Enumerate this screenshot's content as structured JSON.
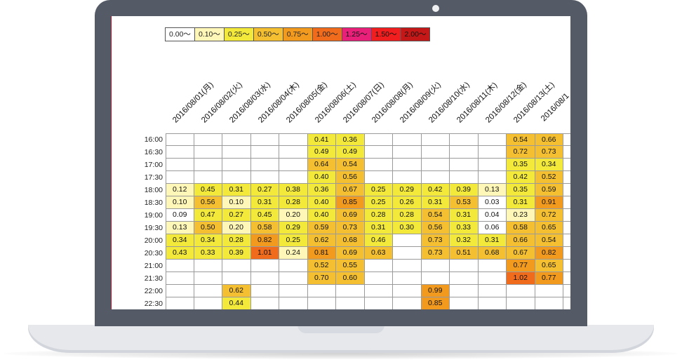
{
  "legend": [
    {
      "label": "0.00〜",
      "color": "#ffffff"
    },
    {
      "label": "0.10〜",
      "color": "#fff7b8"
    },
    {
      "label": "0.25〜",
      "color": "#f2e93a"
    },
    {
      "label": "0.50〜",
      "color": "#f4c032"
    },
    {
      "label": "0.75〜",
      "color": "#f29a1e"
    },
    {
      "label": "1.00〜",
      "color": "#f06b1c"
    },
    {
      "label": "1.25〜",
      "color": "#e8207a"
    },
    {
      "label": "1.50〜",
      "color": "#f01e1e"
    },
    {
      "label": "2.00〜",
      "color": "#c41818"
    }
  ],
  "dates": [
    "2016/08/01(月)",
    "2016/08/02(火)",
    "2016/08/03(水)",
    "2016/08/04(木)",
    "2016/08/05(金)",
    "2016/08/06(土)",
    "2016/08/07(日)",
    "2016/08/08(月)",
    "2016/08/09(火)",
    "2016/08/10(水)",
    "2016/08/11(木)",
    "2016/08/12(金)",
    "2016/08/13(土)",
    "2016/08/1"
  ],
  "times": [
    "16:00",
    "16:30",
    "17:00",
    "17:30",
    "18:00",
    "18:30",
    "19:00",
    "19:30",
    "20:00",
    "20:30",
    "21:00",
    "21:30",
    "22:00",
    "22:30"
  ],
  "rows": [
    [
      "",
      "",
      "",
      "",
      "",
      "0.41",
      "0.36",
      "",
      "",
      "",
      "",
      "",
      "0.54",
      "0.66",
      ""
    ],
    [
      "",
      "",
      "",
      "",
      "",
      "0.49",
      "0.49",
      "",
      "",
      "",
      "",
      "",
      "0.72",
      "0.73",
      ""
    ],
    [
      "",
      "",
      "",
      "",
      "",
      "0.64",
      "0.54",
      "",
      "",
      "",
      "",
      "",
      "0.35",
      "0.34",
      ""
    ],
    [
      "",
      "",
      "",
      "",
      "",
      "0.40",
      "0.56",
      "",
      "",
      "",
      "",
      "",
      "0.42",
      "0.52",
      ""
    ],
    [
      "0.12",
      "0.45",
      "0.31",
      "0.27",
      "0.38",
      "0.36",
      "0.67",
      "0.25",
      "0.29",
      "0.42",
      "0.39",
      "0.13",
      "0.35",
      "0.59",
      ""
    ],
    [
      "0.10",
      "0.56",
      "0.10",
      "0.31",
      "0.28",
      "0.40",
      "0.85",
      "0.25",
      "0.26",
      "0.31",
      "0.53",
      "0.03",
      "0.31",
      "0.91",
      ""
    ],
    [
      "0.09",
      "0.47",
      "0.27",
      "0.45",
      "0.20",
      "0.40",
      "0.69",
      "0.28",
      "0.28",
      "0.54",
      "0.31",
      "0.04",
      "0.23",
      "0.72",
      ""
    ],
    [
      "0.13",
      "0.50",
      "0.20",
      "0.58",
      "0.29",
      "0.59",
      "0.73",
      "0.31",
      "0.30",
      "0.56",
      "0.33",
      "0.06",
      "0.58",
      "0.65",
      ""
    ],
    [
      "0.34",
      "0.34",
      "0.28",
      "0.82",
      "0.25",
      "0.62",
      "0.68",
      "0.46",
      "",
      "0.73",
      "0.32",
      "0.31",
      "0.66",
      "0.54",
      ""
    ],
    [
      "0.43",
      "0.33",
      "0.39",
      "1.01",
      "0.24",
      "0.81",
      "0.69",
      "0.63",
      "",
      "0.73",
      "0.51",
      "0.68",
      "0.67",
      "0.82",
      ""
    ],
    [
      "",
      "",
      "",
      "",
      "",
      "0.52",
      "0.55",
      "",
      "",
      "",
      "",
      "",
      "0.77",
      "0.65",
      ""
    ],
    [
      "",
      "",
      "",
      "",
      "",
      "0.70",
      "0.60",
      "",
      "",
      "",
      "",
      "",
      "1.02",
      "0.77",
      ""
    ],
    [
      "",
      "",
      "0.62",
      "",
      "",
      "",
      "",
      "",
      "",
      "0.99",
      "",
      "",
      "",
      "",
      ""
    ],
    [
      "",
      "",
      "0.44",
      "",
      "",
      "",
      "",
      "",
      "",
      "0.85",
      "",
      "",
      "",
      "",
      ""
    ]
  ]
}
